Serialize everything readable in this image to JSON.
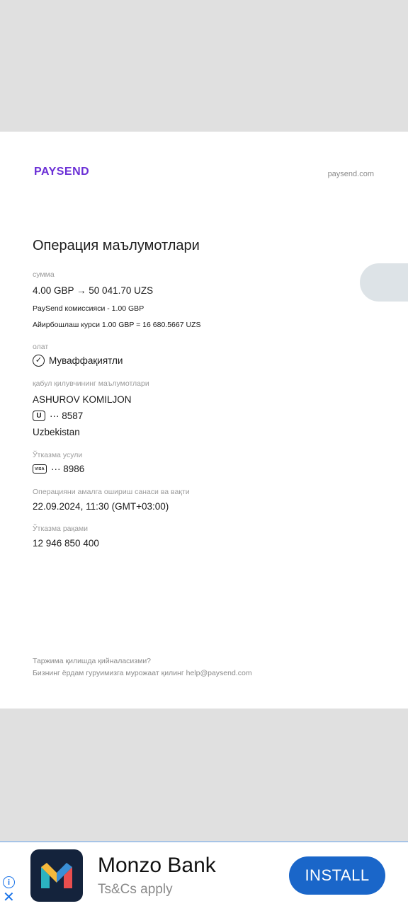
{
  "receipt": {
    "logo": "PAYSEND",
    "site": "paysend.com",
    "title": "Операция маълумотлари",
    "amount": {
      "label": "сумма",
      "value": "4.00 GBP → 50 041.70 UZS",
      "fee": "PaySend комиссияси - 1.00 GBP",
      "rate": "Айирбошлаш курси 1.00 GBP = 16 680.5667 UZS"
    },
    "status": {
      "label": "олат",
      "value": "Муваффақиятли",
      "icon": "check-circle-icon"
    },
    "recipient": {
      "label": "қабул қилувчининг маълумотлари",
      "name": "ASHUROV KOMILJON",
      "card_icon_text": "U",
      "card_number": "··· 8587",
      "country": "Uzbekistan"
    },
    "method": {
      "label": "Ўтказма усули",
      "card_icon_text": "VISA",
      "card_number": "··· 8986"
    },
    "datetime": {
      "label": "Операцияни амалга ошириш санаси ва вақти",
      "value": "22.09.2024, 11:30 (GMT+03:00)"
    },
    "transfer": {
      "label": "Ўтказма рақами",
      "value": "12 946 850 400"
    },
    "help": {
      "line1": "Таржима қилишда қийналасизми?",
      "line2": "Бизнинг ёрдам гуруимизга мурожаат қилинг help@paysend.com"
    }
  },
  "ad": {
    "info_icon": "i",
    "close_icon": "✕",
    "name": "Monzo Bank",
    "subtitle": "Ts&Cs apply",
    "install_label": "INSTALL",
    "brand_colors": [
      "#14233c",
      "#e94e4e",
      "#2bb3c0",
      "#f5b93c"
    ]
  }
}
